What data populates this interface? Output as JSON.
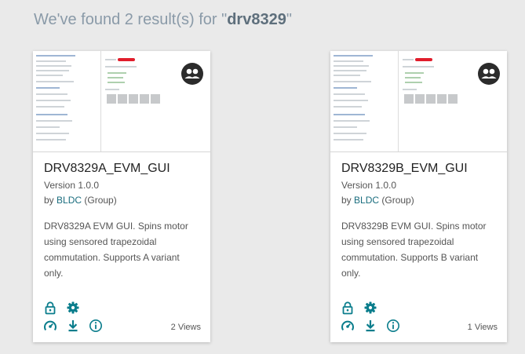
{
  "search": {
    "prefix": "We've found 2 result(s) for \"",
    "query": "drv8329",
    "suffix": "\""
  },
  "accent_color": "#0a7d8c",
  "results": [
    {
      "title": "DRV8329A_EVM_GUI",
      "version": "Version 1.0.0",
      "by_prefix": "by ",
      "author": "BLDC",
      "author_suffix": " (Group)",
      "description": "DRV8329A EVM GUI. Spins motor using sensored trapezoidal commutation. Supports A variant only.",
      "views": "2 Views",
      "icons": [
        "group-icon",
        "lock-icon",
        "gear-icon",
        "dashboard-icon",
        "download-icon",
        "info-icon"
      ]
    },
    {
      "title": "DRV8329B_EVM_GUI",
      "version": "Version 1.0.0",
      "by_prefix": "by ",
      "author": "BLDC",
      "author_suffix": " (Group)",
      "description": "DRV8329B EVM GUI. Spins motor using sensored trapezoidal commutation. Supports B variant only.",
      "views": "1 Views",
      "icons": [
        "group-icon",
        "lock-icon",
        "gear-icon",
        "dashboard-icon",
        "download-icon",
        "info-icon"
      ]
    }
  ]
}
